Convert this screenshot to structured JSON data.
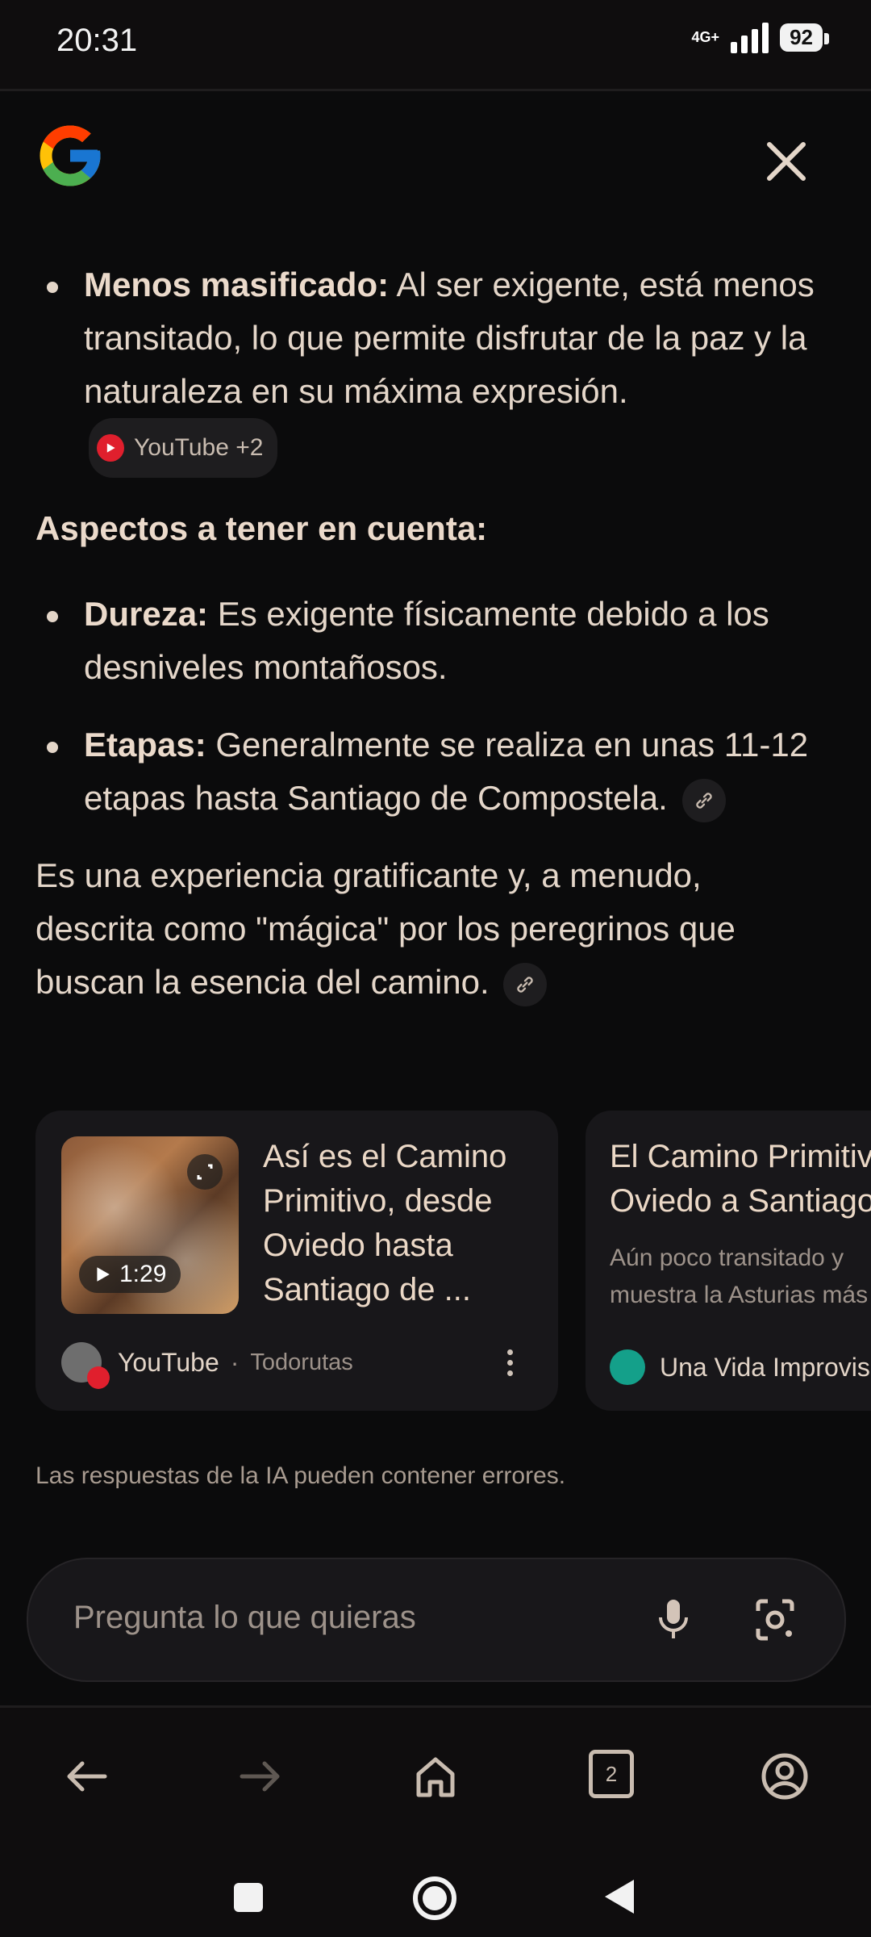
{
  "status_bar": {
    "time": "20:31",
    "network": "4G+",
    "battery": "92"
  },
  "header": {
    "logo": "google-g-logo",
    "close_icon": "close-icon"
  },
  "content": {
    "bullet1": {
      "label": "Menos masificado:",
      "text": " Al ser exigente, está menos transitado, lo que permite disfrutar de la paz y la naturaleza en su máxima expresión.",
      "source_chip": "YouTube +2"
    },
    "heading": "Aspectos a tener en cuenta:",
    "bullet2": {
      "label": "Dureza:",
      "text": " Es exigente físicamente debido a los desniveles montañosos."
    },
    "bullet3": {
      "label": "Etapas:",
      "text": " Generalmente se realiza en unas 11-12 etapas hasta Santiago de Compostela."
    },
    "paragraph": "Es una experiencia gratificante y, a menudo, descrita como \"mágica\" por los peregrinos que buscan la esencia del camino."
  },
  "cards": [
    {
      "title": "Así es el Camino Primitivo, desde Oviedo hasta Santiago de ...",
      "duration": "1:29",
      "source": "YouTube",
      "author": "Todorutas"
    },
    {
      "title_line1": "El Camino Primitivo",
      "title_line2": "Oviedo a Santiago",
      "desc_line1": "Aún poco transitado y",
      "desc_line2": "muestra la Asturias más",
      "source": "Una Vida Improvisada"
    }
  ],
  "disclaimer": "Las respuestas de la IA pueden contener errores.",
  "search": {
    "placeholder": "Pregunta lo que quieras"
  },
  "bottom_nav": {
    "tab_count": "2"
  },
  "colors": {
    "background": "#0b0b0c",
    "text": "#e4d6c9",
    "card": "#18171a"
  }
}
